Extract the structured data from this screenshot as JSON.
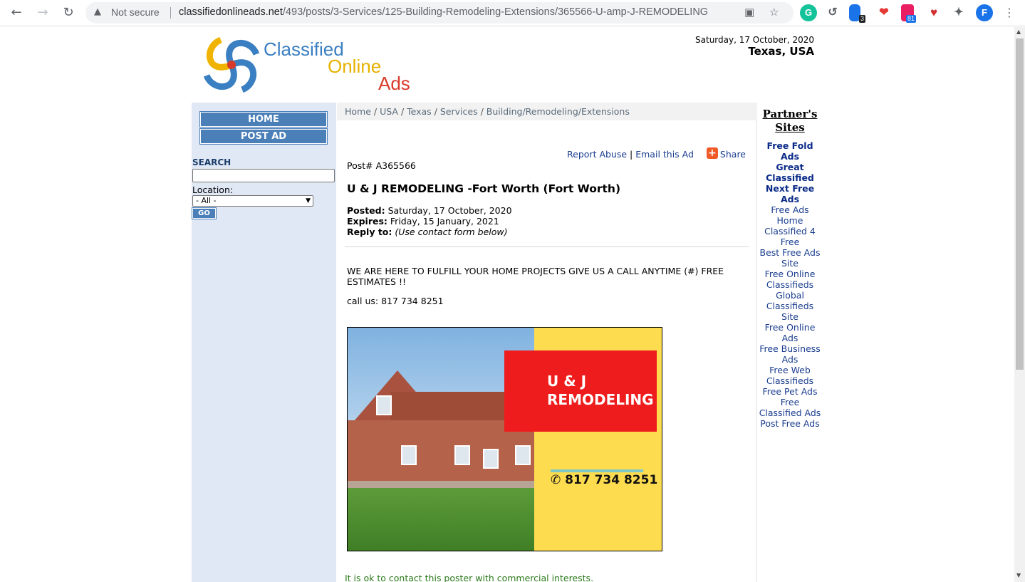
{
  "browser": {
    "security_label": "Not secure",
    "url_host": "classifiedonlineads.net",
    "url_path": "/493/posts/3-Services/125-Building-Remodeling-Extensions/365566-U-amp-J-REMODELING",
    "ext_badge_1": "3",
    "ext_badge_2": "81",
    "profile_initial": "F"
  },
  "header": {
    "logo_line1": "Classified",
    "logo_line2": "Online",
    "logo_line3": "Ads",
    "date": "Saturday, 17 October, 2020",
    "location": "Texas, USA"
  },
  "sidebar": {
    "home_label": "HOME",
    "post_ad_label": "POST AD",
    "search_label": "SEARCH",
    "search_value": "",
    "location_label": "Location:",
    "location_selected": "- All -",
    "go_label": "GO"
  },
  "breadcrumb": [
    "Home",
    "USA",
    "Texas",
    "Services",
    "Building/Remodeling/Extensions"
  ],
  "ad": {
    "report_abuse": "Report Abuse",
    "email_ad": "Email this Ad",
    "share": "Share",
    "post_number": "Post# A365566",
    "title": "U & J REMODELING -Fort Worth (Fort Worth)",
    "posted_label": "Posted:",
    "posted_value": "Saturday, 17 October, 2020",
    "expires_label": "Expires:",
    "expires_value": "Friday, 15 January, 2021",
    "reply_label": "Reply to:",
    "reply_value": "(Use contact form below)",
    "description": "WE ARE HERE TO FULFILL YOUR HOME PROJECTS GIVE US A CALL ANYTIME (#) FREE ESTIMATES !!",
    "call": "call us: 817 734 8251",
    "image_title_line1": "U & J",
    "image_title_line2": "REMODELING",
    "image_phone": "817 734 8251",
    "commercial_note": "It is ok to contact this poster with commercial interests."
  },
  "partners": {
    "title_line1": "Partner's",
    "title_line2": "Sites",
    "links": [
      {
        "label": "Free Fold Ads",
        "bold": true
      },
      {
        "label": "Great Classified",
        "bold": true
      },
      {
        "label": "Next Free Ads",
        "bold": true
      },
      {
        "label": "Free Ads Home",
        "bold": false
      },
      {
        "label": "Classified 4 Free",
        "bold": false
      },
      {
        "label": "Best Free Ads Site",
        "bold": false
      },
      {
        "label": "Free Online Classifieds",
        "bold": false
      },
      {
        "label": "Global Classifieds Site",
        "bold": false
      },
      {
        "label": "Free Online Ads",
        "bold": false
      },
      {
        "label": "Free Business Ads",
        "bold": false
      },
      {
        "label": "Free Web Classifieds",
        "bold": false
      },
      {
        "label": "Free Pet Ads",
        "bold": false
      },
      {
        "label": "Free Classified Ads",
        "bold": false
      },
      {
        "label": "Post Free Ads",
        "bold": false
      }
    ]
  }
}
